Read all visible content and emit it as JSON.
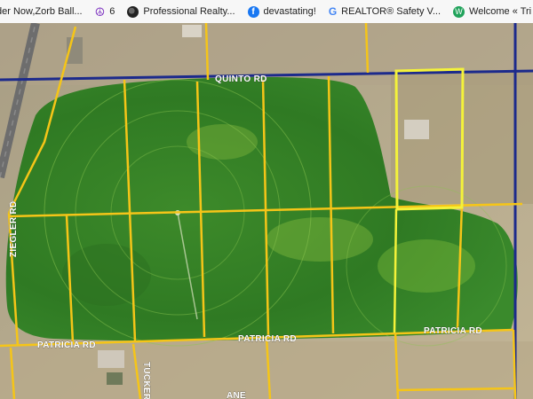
{
  "bookmarks": [
    {
      "icon": "bookmark-icon",
      "label": "der Now,Zorb Ball..."
    },
    {
      "icon": "peace-sign-icon",
      "label": "6"
    },
    {
      "icon": "globe-icon",
      "label": "Professional Realty..."
    },
    {
      "icon": "facebook-icon",
      "label": "devastating!"
    },
    {
      "icon": "google-icon",
      "label": "REALTOR® Safety V..."
    },
    {
      "icon": "wordpress-icon",
      "label": "Welcome « Tri City..."
    },
    {
      "icon": "pin-icon",
      "label": ""
    }
  ],
  "map": {
    "type": "satellite parcel map",
    "roads": {
      "quinto": "QUINTO RD",
      "ziegler": "ZIEGLER RD",
      "patricia_left": "PATRICIA RD",
      "patricia_center": "PATRICIA RD",
      "patricia_right": "PATRICIA RD",
      "tucker": "TUCKER",
      "bottom_fragment": "ANE"
    },
    "colors": {
      "parcel_lines": "#f5c518",
      "highlight_parcel": "#f4f23a",
      "county_line": "#1c2a8c",
      "crop_field": "#3e8f2c",
      "dry_land": "#b9ab8c"
    }
  }
}
